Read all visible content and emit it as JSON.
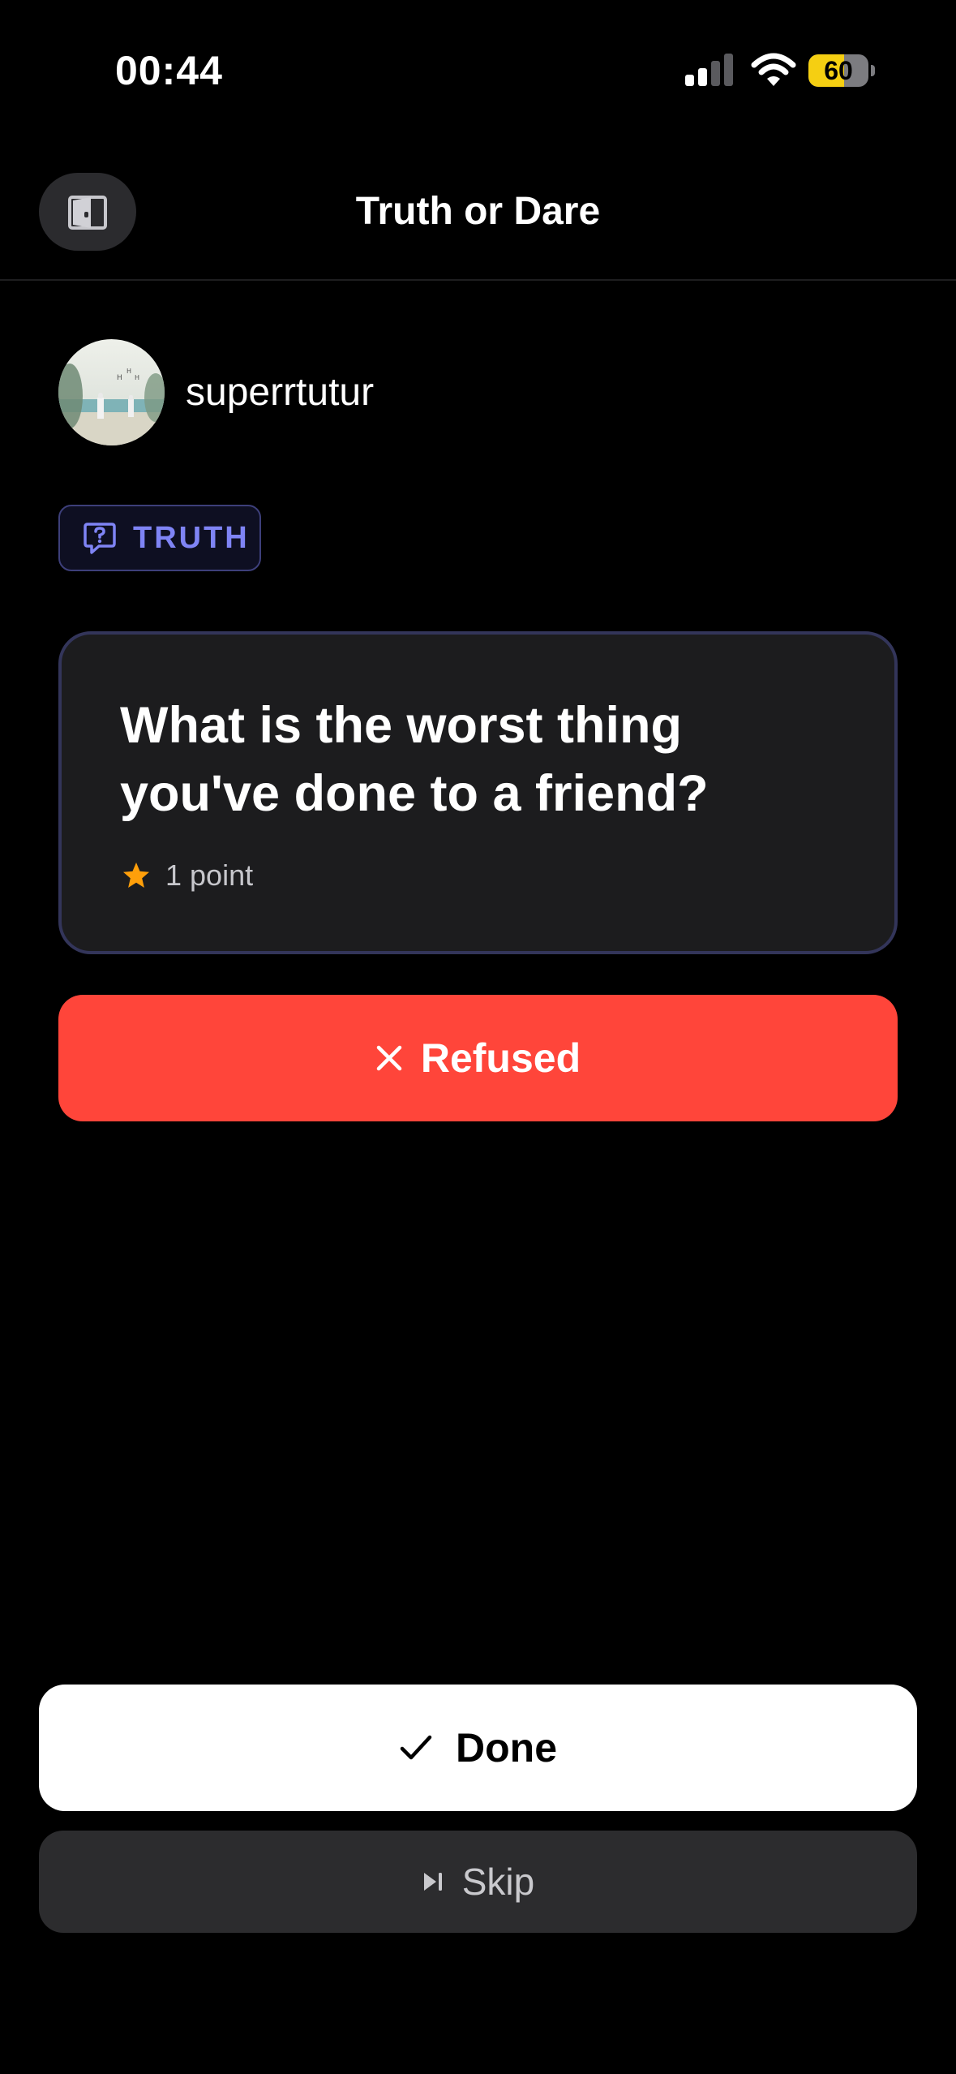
{
  "status_bar": {
    "time": "00:44",
    "battery": "60",
    "battery_level": 0.6,
    "icons": [
      "cellular-signal-icon",
      "wifi-icon",
      "battery-icon"
    ]
  },
  "header": {
    "title": "Truth or Dare",
    "exit_icon": "door-exit-icon"
  },
  "player": {
    "name": "superrtutur"
  },
  "prompt": {
    "type_label": "TRUTH",
    "type_icon": "question-bubble-icon",
    "question": "What is the worst thing you've done to a friend?",
    "points_label": "1 point",
    "points_icon": "star-icon"
  },
  "actions": {
    "refused_label": "Refused",
    "done_label": "Done",
    "skip_label": "Skip"
  },
  "colors": {
    "refused": "#ff453a",
    "badge_accent": "#7f84f5",
    "star": "#ff9f0a",
    "battery_fill": "#f5cf12"
  }
}
